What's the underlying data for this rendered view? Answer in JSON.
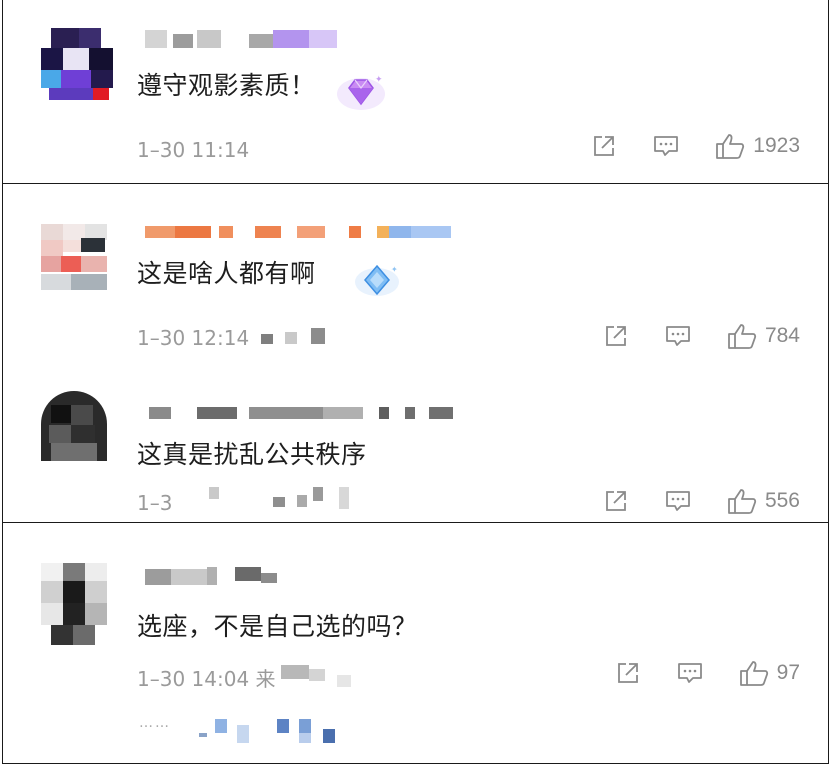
{
  "comments": [
    {
      "text": "遵守观影素质！",
      "date": "1–30 11:14",
      "likes": "1923",
      "badge": "purple-diamond-icon"
    },
    {
      "text": "这是啥人都有啊",
      "date": "1–30 12:14",
      "likes": "784",
      "badge": "blue-diamond-icon"
    },
    {
      "text": "这真是扰乱公共秩序",
      "date": "1–3",
      "likes": "556"
    },
    {
      "text": "选座，不是自己选的吗？",
      "date": "1–30 14:04 来",
      "likes": "97",
      "reply_dots": "……"
    }
  ],
  "colors": {
    "text": "#1e1e1e",
    "meta": "#9a9a9a",
    "icon": "#8a8a8a",
    "border": "#1a1a1a"
  }
}
